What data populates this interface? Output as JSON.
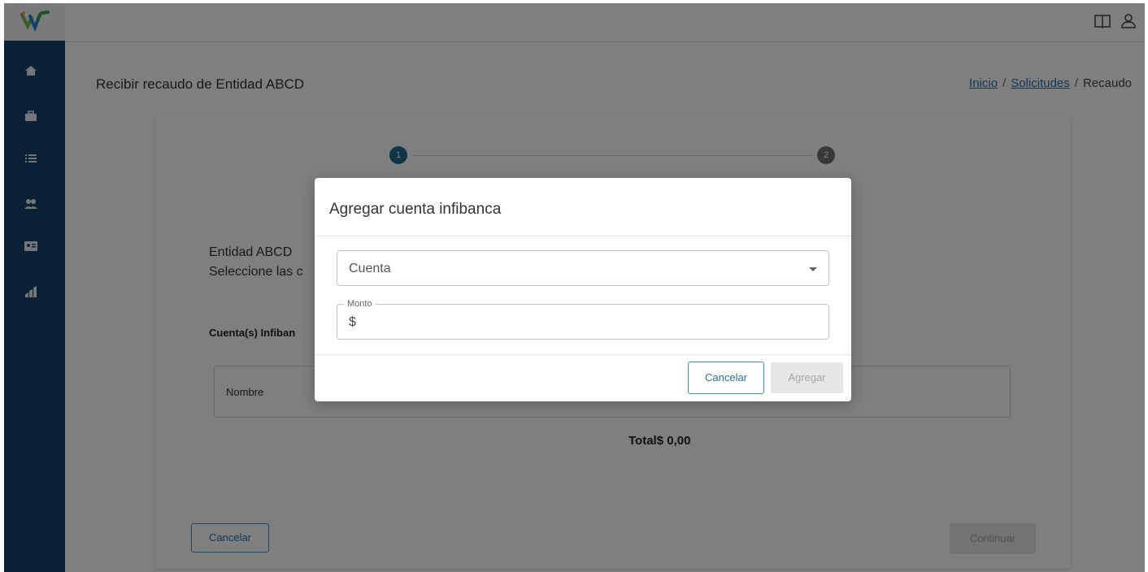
{
  "colors": {
    "sidebar": "#15426b",
    "primary": "#2a6fa8",
    "step_active": "#1f6a8e",
    "step_inactive": "#6b6f73",
    "overlay": "rgba(0,0,0,0.5)"
  },
  "sidebar": {
    "items": [
      {
        "icon": "home-icon"
      },
      {
        "icon": "briefcase-icon"
      },
      {
        "icon": "list-icon"
      },
      {
        "icon": "users-icon"
      },
      {
        "icon": "id-card-icon"
      },
      {
        "icon": "chart-icon"
      }
    ]
  },
  "topbar": {
    "icons": [
      "book-icon",
      "user-icon"
    ]
  },
  "header": {
    "title": "Recibir recaudo de Entidad ABCD",
    "breadcrumb": {
      "inicio": "Inicio",
      "solicitudes": "Solicitudes",
      "current": "Recaudo",
      "separator": "/"
    }
  },
  "stepper": {
    "step1": "1",
    "step2": "2"
  },
  "content": {
    "line1": "Entidad ABCD",
    "line2": "Seleccione las c",
    "section_title": "Cuenta(s) Infiban",
    "table_header": "Nombre",
    "total": "Total$ 0,00",
    "cancel_label": "Cancelar",
    "continue_label": "Continuar"
  },
  "modal": {
    "title": "Agregar cuenta infibanca",
    "select_value": "Cuenta",
    "amount_label": "Monto",
    "amount_prefix": "$",
    "amount_value": "",
    "cancel_label": "Cancelar",
    "add_label": "Agregar"
  }
}
